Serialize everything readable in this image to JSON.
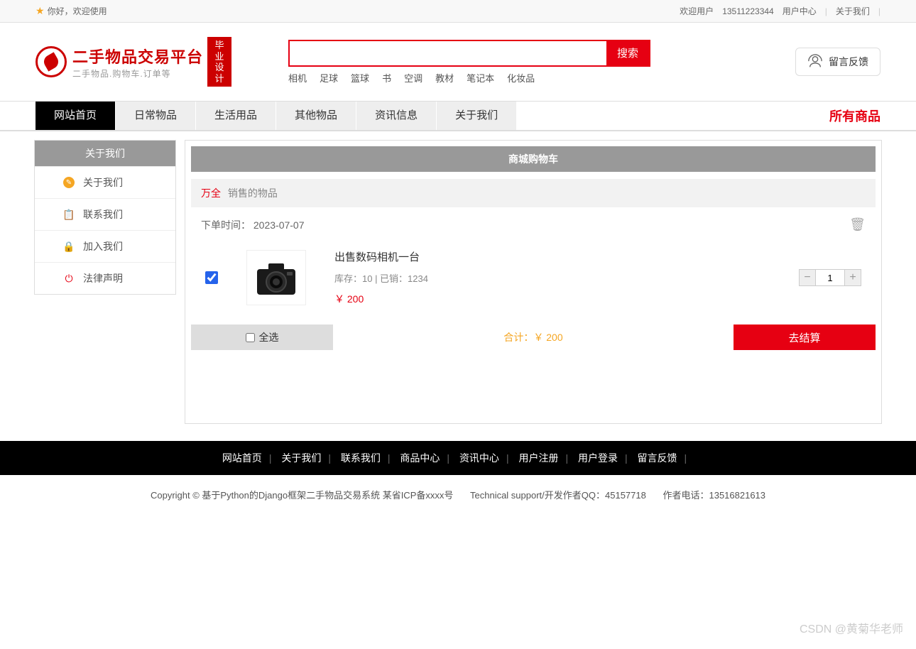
{
  "top": {
    "welcome": "你好，欢迎使用",
    "welcome_user": "欢迎用户",
    "phone": "13511223344",
    "user_center": "用户中心",
    "about": "关于我们"
  },
  "logo": {
    "title": "二手物品交易平台",
    "sub": "二手物品.购物车.订单等",
    "badge": "毕业设计"
  },
  "search": {
    "button": "搜索",
    "hot": [
      "相机",
      "足球",
      "篮球",
      "书",
      "空调",
      "教材",
      "笔记本",
      "化妆品"
    ]
  },
  "feedback": {
    "label": "留言反馈"
  },
  "nav": {
    "items": [
      "网站首页",
      "日常物品",
      "生活用品",
      "其他物品",
      "资讯信息",
      "关于我们"
    ],
    "all": "所有商品"
  },
  "sidebar": {
    "title": "关于我们",
    "items": [
      {
        "label": "关于我们"
      },
      {
        "label": "联系我们"
      },
      {
        "label": "加入我们"
      },
      {
        "label": "法律声明"
      }
    ]
  },
  "cart": {
    "title": "商城购物车",
    "filter_red": "万全",
    "filter_grey": "销售的物品",
    "order_time_label": "下单时间：",
    "order_time": "2023-07-07",
    "item": {
      "title": "出售数码相机一台",
      "meta": "库存：10 | 已销：1234",
      "price": "￥ 200",
      "qty": "1"
    },
    "select_all": "全选",
    "total_label": "合计：",
    "total_value": "￥ 200",
    "checkout": "去结算"
  },
  "footer": {
    "nav": [
      "网站首页",
      "关于我们",
      "联系我们",
      "商品中心",
      "资讯中心",
      "用户注册",
      "用户登录",
      "留言反馈"
    ],
    "info1": "Copyright © 基于Python的Django框架二手物品交易系统 某省ICP备xxxx号",
    "info2": "Technical support/开发作者QQ：45157718",
    "info3": "作者电话：13516821613"
  },
  "watermark": "CSDN @黄菊华老师"
}
